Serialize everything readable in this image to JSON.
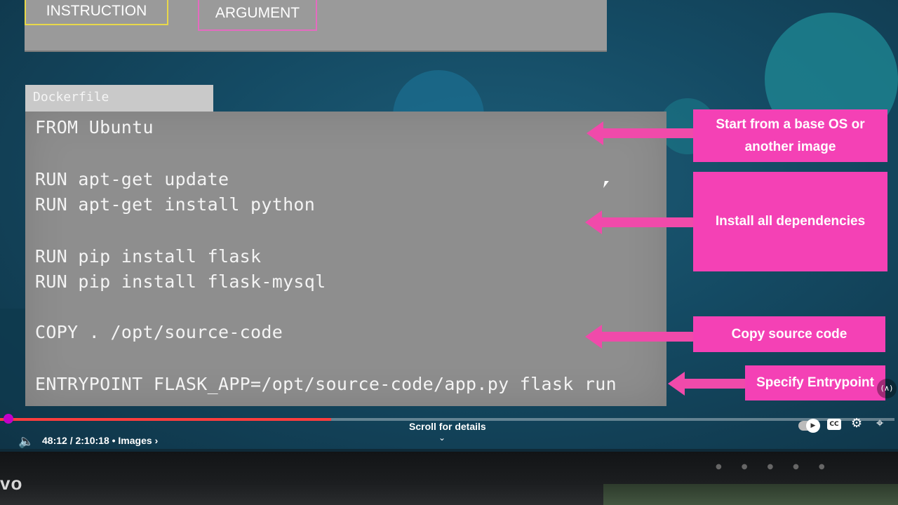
{
  "legend": {
    "instruction": "INSTRUCTION",
    "argument": "ARGUMENT"
  },
  "dockerfile": {
    "tab_label": "Dockerfile",
    "lines": [
      "FROM Ubuntu",
      "RUN apt-get update",
      "RUN apt-get install python",
      "RUN pip install flask",
      "RUN pip install flask-mysql",
      "COPY . /opt/source-code",
      "ENTRYPOINT FLASK_APP=/opt/source-code/app.py flask run"
    ]
  },
  "callouts": {
    "base_os": "Start from a base OS or another image",
    "dependencies": "Install all dependencies",
    "copy": "Copy source code",
    "entrypoint": "Specify Entrypoint"
  },
  "player": {
    "time": "48:12 / 2:10:18",
    "chapter": "Images",
    "scroll_hint": "Scroll for details",
    "progress_fraction": 0.37,
    "buffer_fraction": 0.37,
    "accent_color": "#ff3d3d",
    "scrubber_color": "#c300c8"
  },
  "colors": {
    "callout": "#f441b5",
    "instruction_border": "#e8d84a",
    "argument_border": "#e46bc0"
  },
  "icons": {
    "volume": "volume-icon",
    "autoplay": "autoplay-toggle",
    "captions": "cc-icon",
    "settings": "gear-icon",
    "fullscreen": "fullscreen-icon"
  }
}
